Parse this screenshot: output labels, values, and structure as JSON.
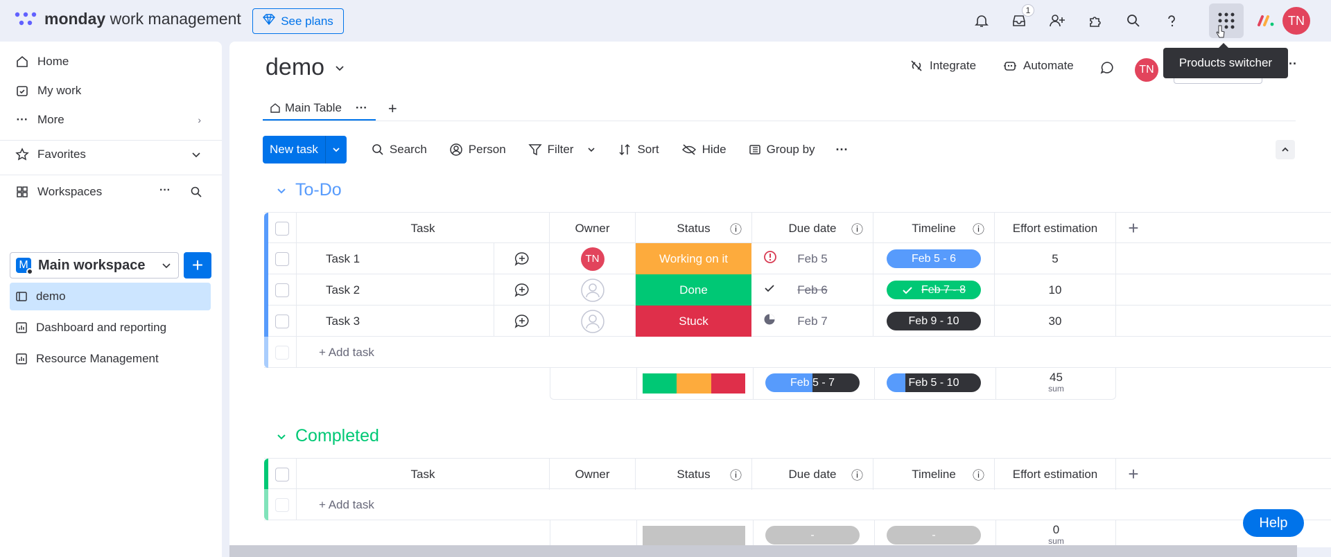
{
  "topbar": {
    "brand_bold": "monday",
    "brand_rest": " work management",
    "see_plans": "See plans",
    "inbox_badge": "1",
    "avatar_initials": "TN",
    "tooltip": "Products switcher",
    "icons": [
      "bell-icon",
      "inbox-icon",
      "invite-icon",
      "apps-icon",
      "search-icon",
      "help-icon",
      "grid-icon"
    ]
  },
  "sidebar": {
    "home": "Home",
    "my_work": "My work",
    "more": "More",
    "favorites": "Favorites",
    "workspaces": "Workspaces",
    "workspace_name": "Main workspace",
    "workspace_initial": "M",
    "boards": [
      "demo",
      "Dashboard and reporting",
      "Resource Management"
    ]
  },
  "board": {
    "title": "demo",
    "integrate": "Integrate",
    "automate": "Automate",
    "avatar": "TN",
    "tab_main": "Main Table",
    "new_task": "New task",
    "toolbar": {
      "search": "Search",
      "person": "Person",
      "filter": "Filter",
      "sort": "Sort",
      "hide": "Hide",
      "group_by": "Group by"
    }
  },
  "columns": [
    "Task",
    "Owner",
    "Status",
    "Due date",
    "Timeline",
    "Effort estimation"
  ],
  "groups": [
    {
      "title": "To-Do",
      "color": "#579bfc",
      "tasks": [
        {
          "name": "Task 1",
          "owner": "TN",
          "status": "Working on it",
          "status_color": "#fdab3d",
          "due": "Feb 5",
          "timeline": "Feb 5 - 6",
          "effort": "5"
        },
        {
          "name": "Task 2",
          "owner": "",
          "status": "Done",
          "status_color": "#00c875",
          "due": "Feb 6",
          "timeline": "Feb 7 - 8",
          "effort": "10"
        },
        {
          "name": "Task 3",
          "owner": "",
          "status": "Stuck",
          "status_color": "#df2f4a",
          "due": "Feb 7",
          "timeline": "Feb 9 - 10",
          "effort": "30"
        }
      ],
      "add_task": "+ Add task",
      "summary": {
        "due": "Feb 5 - 7",
        "timeline": "Feb 5 - 10",
        "effort": "45",
        "effort_label": "sum"
      }
    },
    {
      "title": "Completed",
      "color": "#00c875",
      "tasks": [],
      "add_task": "+ Add task",
      "summary": {
        "due": "-",
        "timeline": "-",
        "effort": "0",
        "effort_label": "sum"
      }
    }
  ],
  "help": "Help"
}
